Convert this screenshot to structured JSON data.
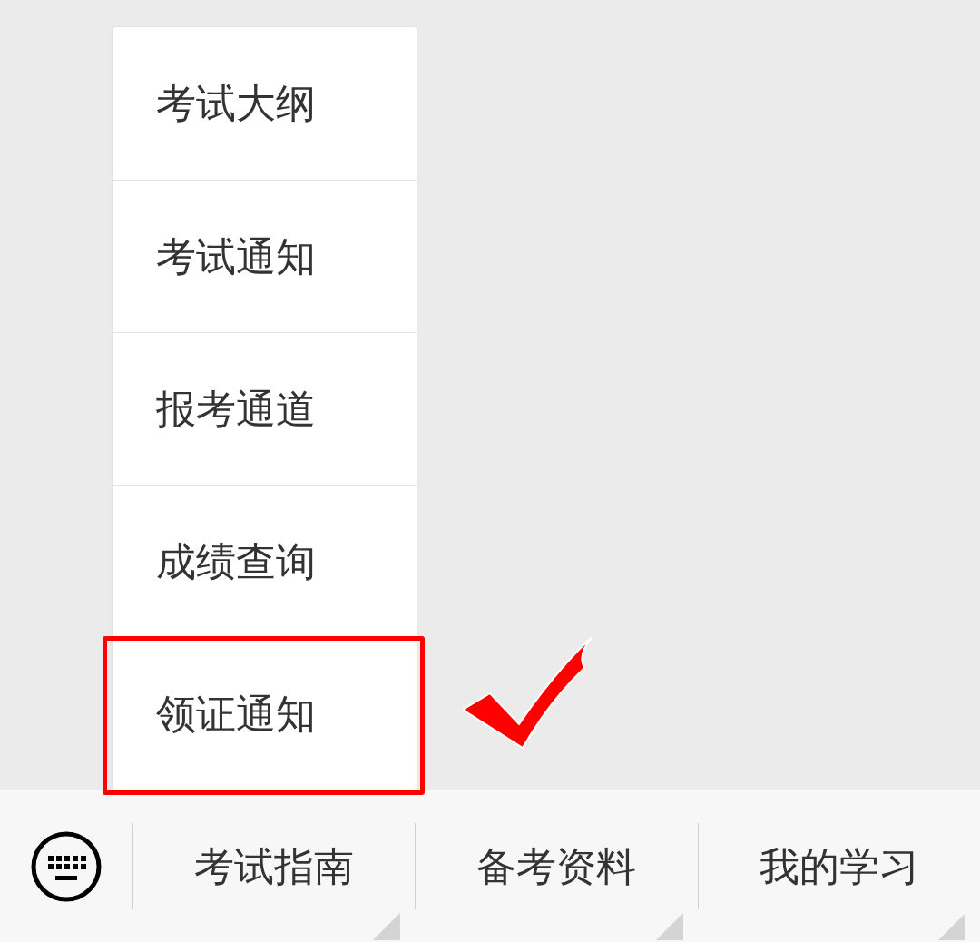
{
  "menu": {
    "items": [
      {
        "label": "考试大纲",
        "highlighted": false
      },
      {
        "label": "考试通知",
        "highlighted": false
      },
      {
        "label": "报考通道",
        "highlighted": false
      },
      {
        "label": "成绩查询",
        "highlighted": false
      },
      {
        "label": "领证通知",
        "highlighted": true
      }
    ]
  },
  "bottom_bar": {
    "tabs": [
      {
        "label": "考试指南"
      },
      {
        "label": "备考资料"
      },
      {
        "label": "我的学习"
      }
    ]
  }
}
